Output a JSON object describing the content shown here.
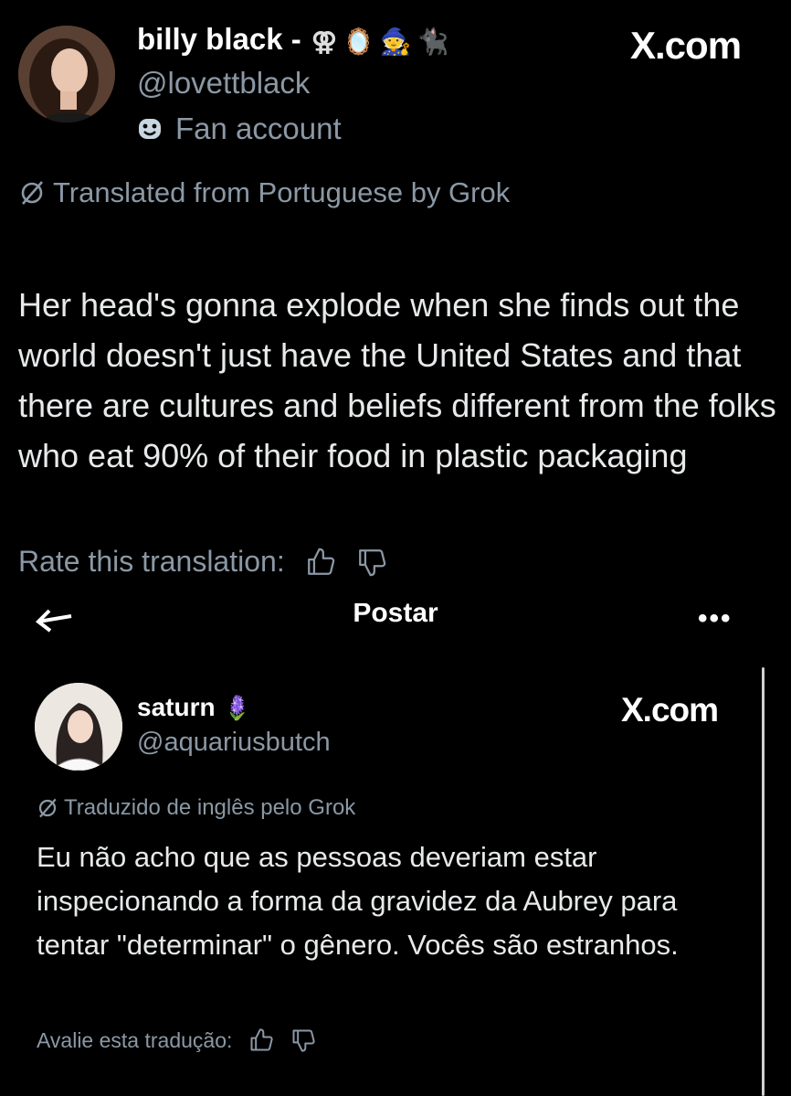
{
  "tweet": {
    "display_name": "billy black -",
    "name_emojis": [
      "⚢",
      "🪞",
      "🧙",
      "🐈‍⬛"
    ],
    "handle": "@lovettblack",
    "account_label": "Fan account",
    "brand": "X.com",
    "translated_note": "Translated from Portuguese by Grok",
    "text": "Her head's gonna explode when she finds out the world doesn't just have the United States and that there are cultures and beliefs different from the folks who eat 90% of their food in plastic packaging",
    "rate_label": "Rate this translation:"
  },
  "nav": {
    "title": "Postar",
    "more": "•••"
  },
  "quoted": {
    "display_name": "saturn",
    "name_emoji": "🪻",
    "handle": "@aquariusbutch",
    "brand": "X.com",
    "translated_note": "Traduzido de inglês pelo Grok",
    "text": "Eu não acho que as pessoas deveriam estar inspecionando a forma da gravidez da Aubrey para tentar \"determinar\" o gênero. Vocês são estranhos.",
    "rate_label": "Avalie esta tradução:"
  },
  "colors": {
    "background": "#000000",
    "text": "#e7e9ea",
    "secondary": "#8b98a5"
  }
}
